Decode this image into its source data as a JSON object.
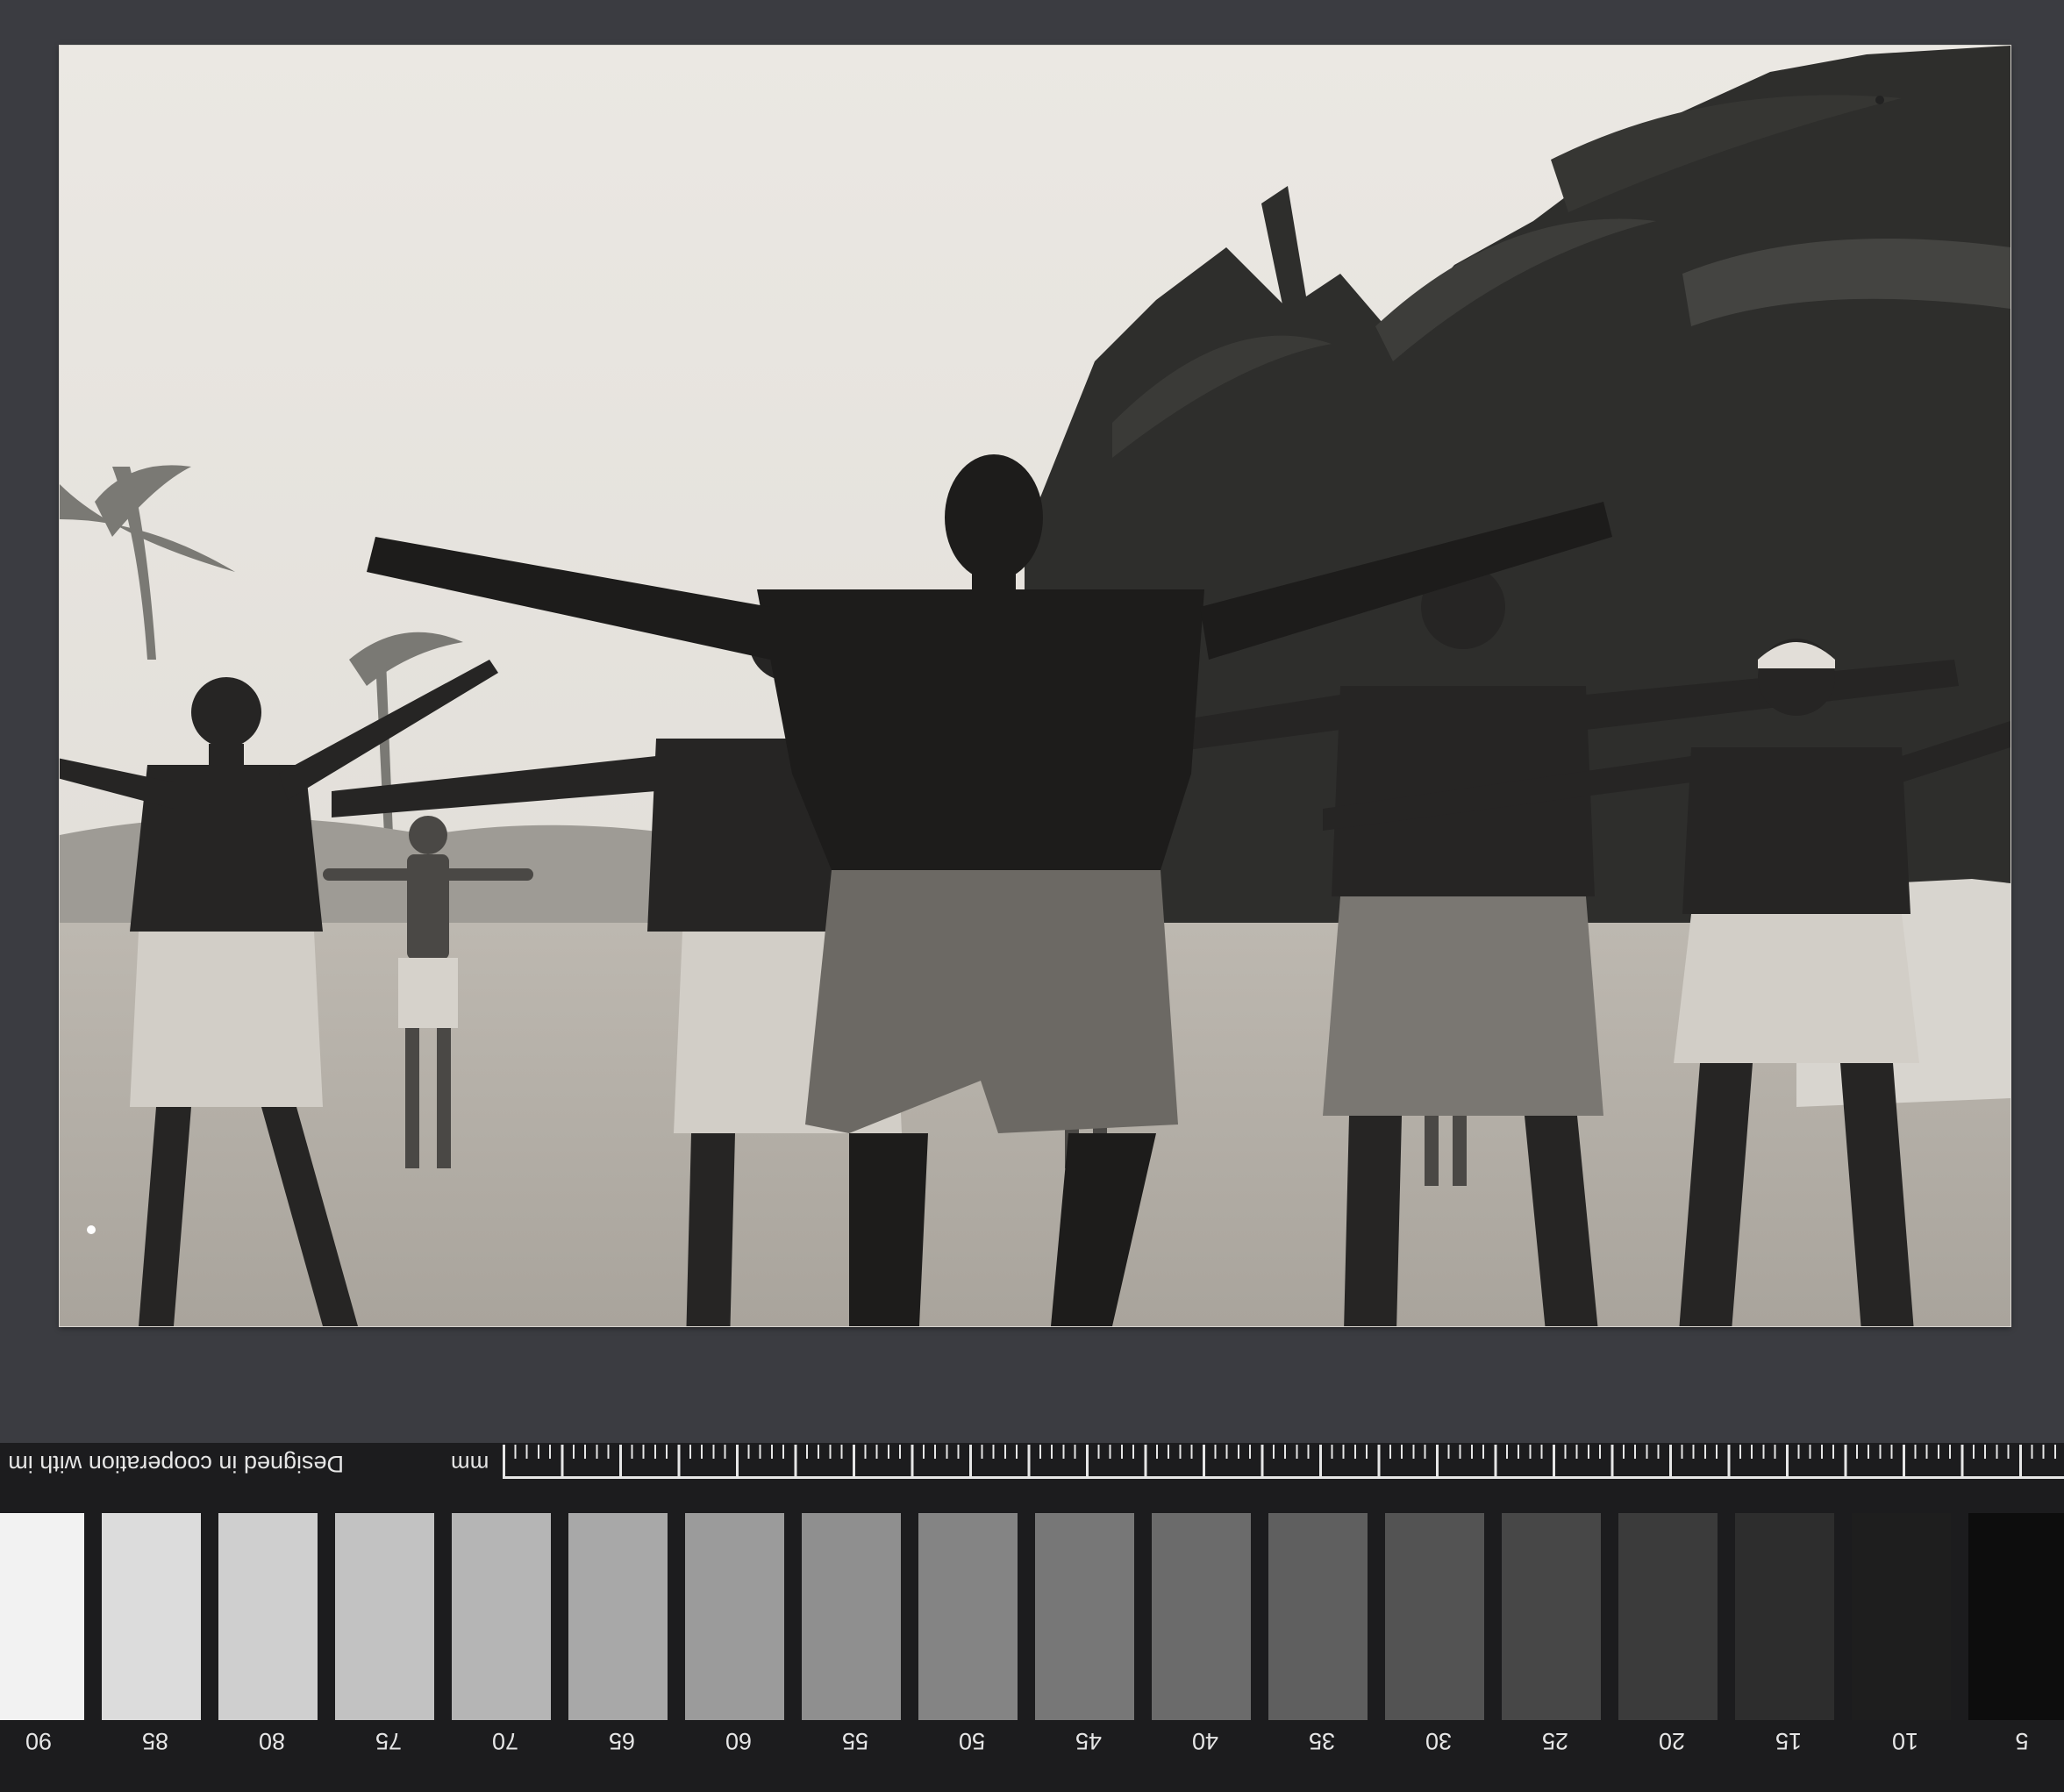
{
  "target": {
    "credit_text": "Designed in cooperation with im",
    "unit_label": "mm",
    "patch_numbers": [
      "90",
      "85",
      "80",
      "75",
      "70",
      "65",
      "60",
      "55",
      "50",
      "45",
      "40",
      "35",
      "30",
      "25",
      "20",
      "15",
      "10",
      "5"
    ],
    "patch_colors": [
      "#f2f2f2",
      "#dcdcdc",
      "#cfcfcf",
      "#c2c2c2",
      "#b5b5b5",
      "#a8a8a8",
      "#9b9b9b",
      "#8f8f8f",
      "#848484",
      "#777777",
      "#6b6b6b",
      "#5f5f5f",
      "#535353",
      "#474747",
      "#3b3b3b",
      "#2d2d2d",
      "#1e1e1e",
      "#0d0d0d"
    ]
  }
}
